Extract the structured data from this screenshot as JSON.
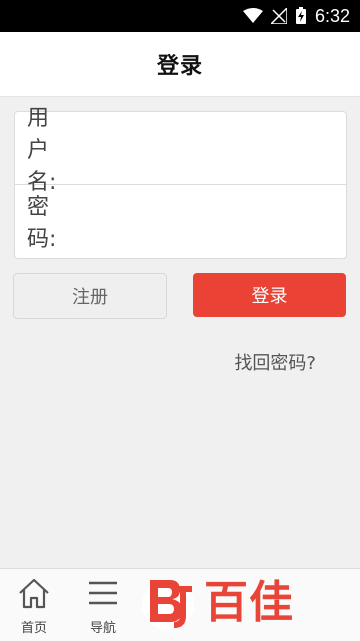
{
  "status_bar": {
    "time": "6:32"
  },
  "header": {
    "title": "登录"
  },
  "form": {
    "username_label": "用户名:",
    "password_label": "密码:",
    "username_value": "",
    "password_value": ""
  },
  "buttons": {
    "register": "注册",
    "login": "登录"
  },
  "links": {
    "forgot_password": "找回密码?"
  },
  "bottom_nav": {
    "items": [
      {
        "label": "首页",
        "icon": "home-icon"
      },
      {
        "label": "导航",
        "icon": "menu-icon"
      }
    ]
  },
  "logo": {
    "brand_text": "百佳",
    "mark_text": "BJ"
  },
  "colors": {
    "accent": "#ea4335",
    "background": "#f0f0f0",
    "logo_red": "#e94438"
  }
}
